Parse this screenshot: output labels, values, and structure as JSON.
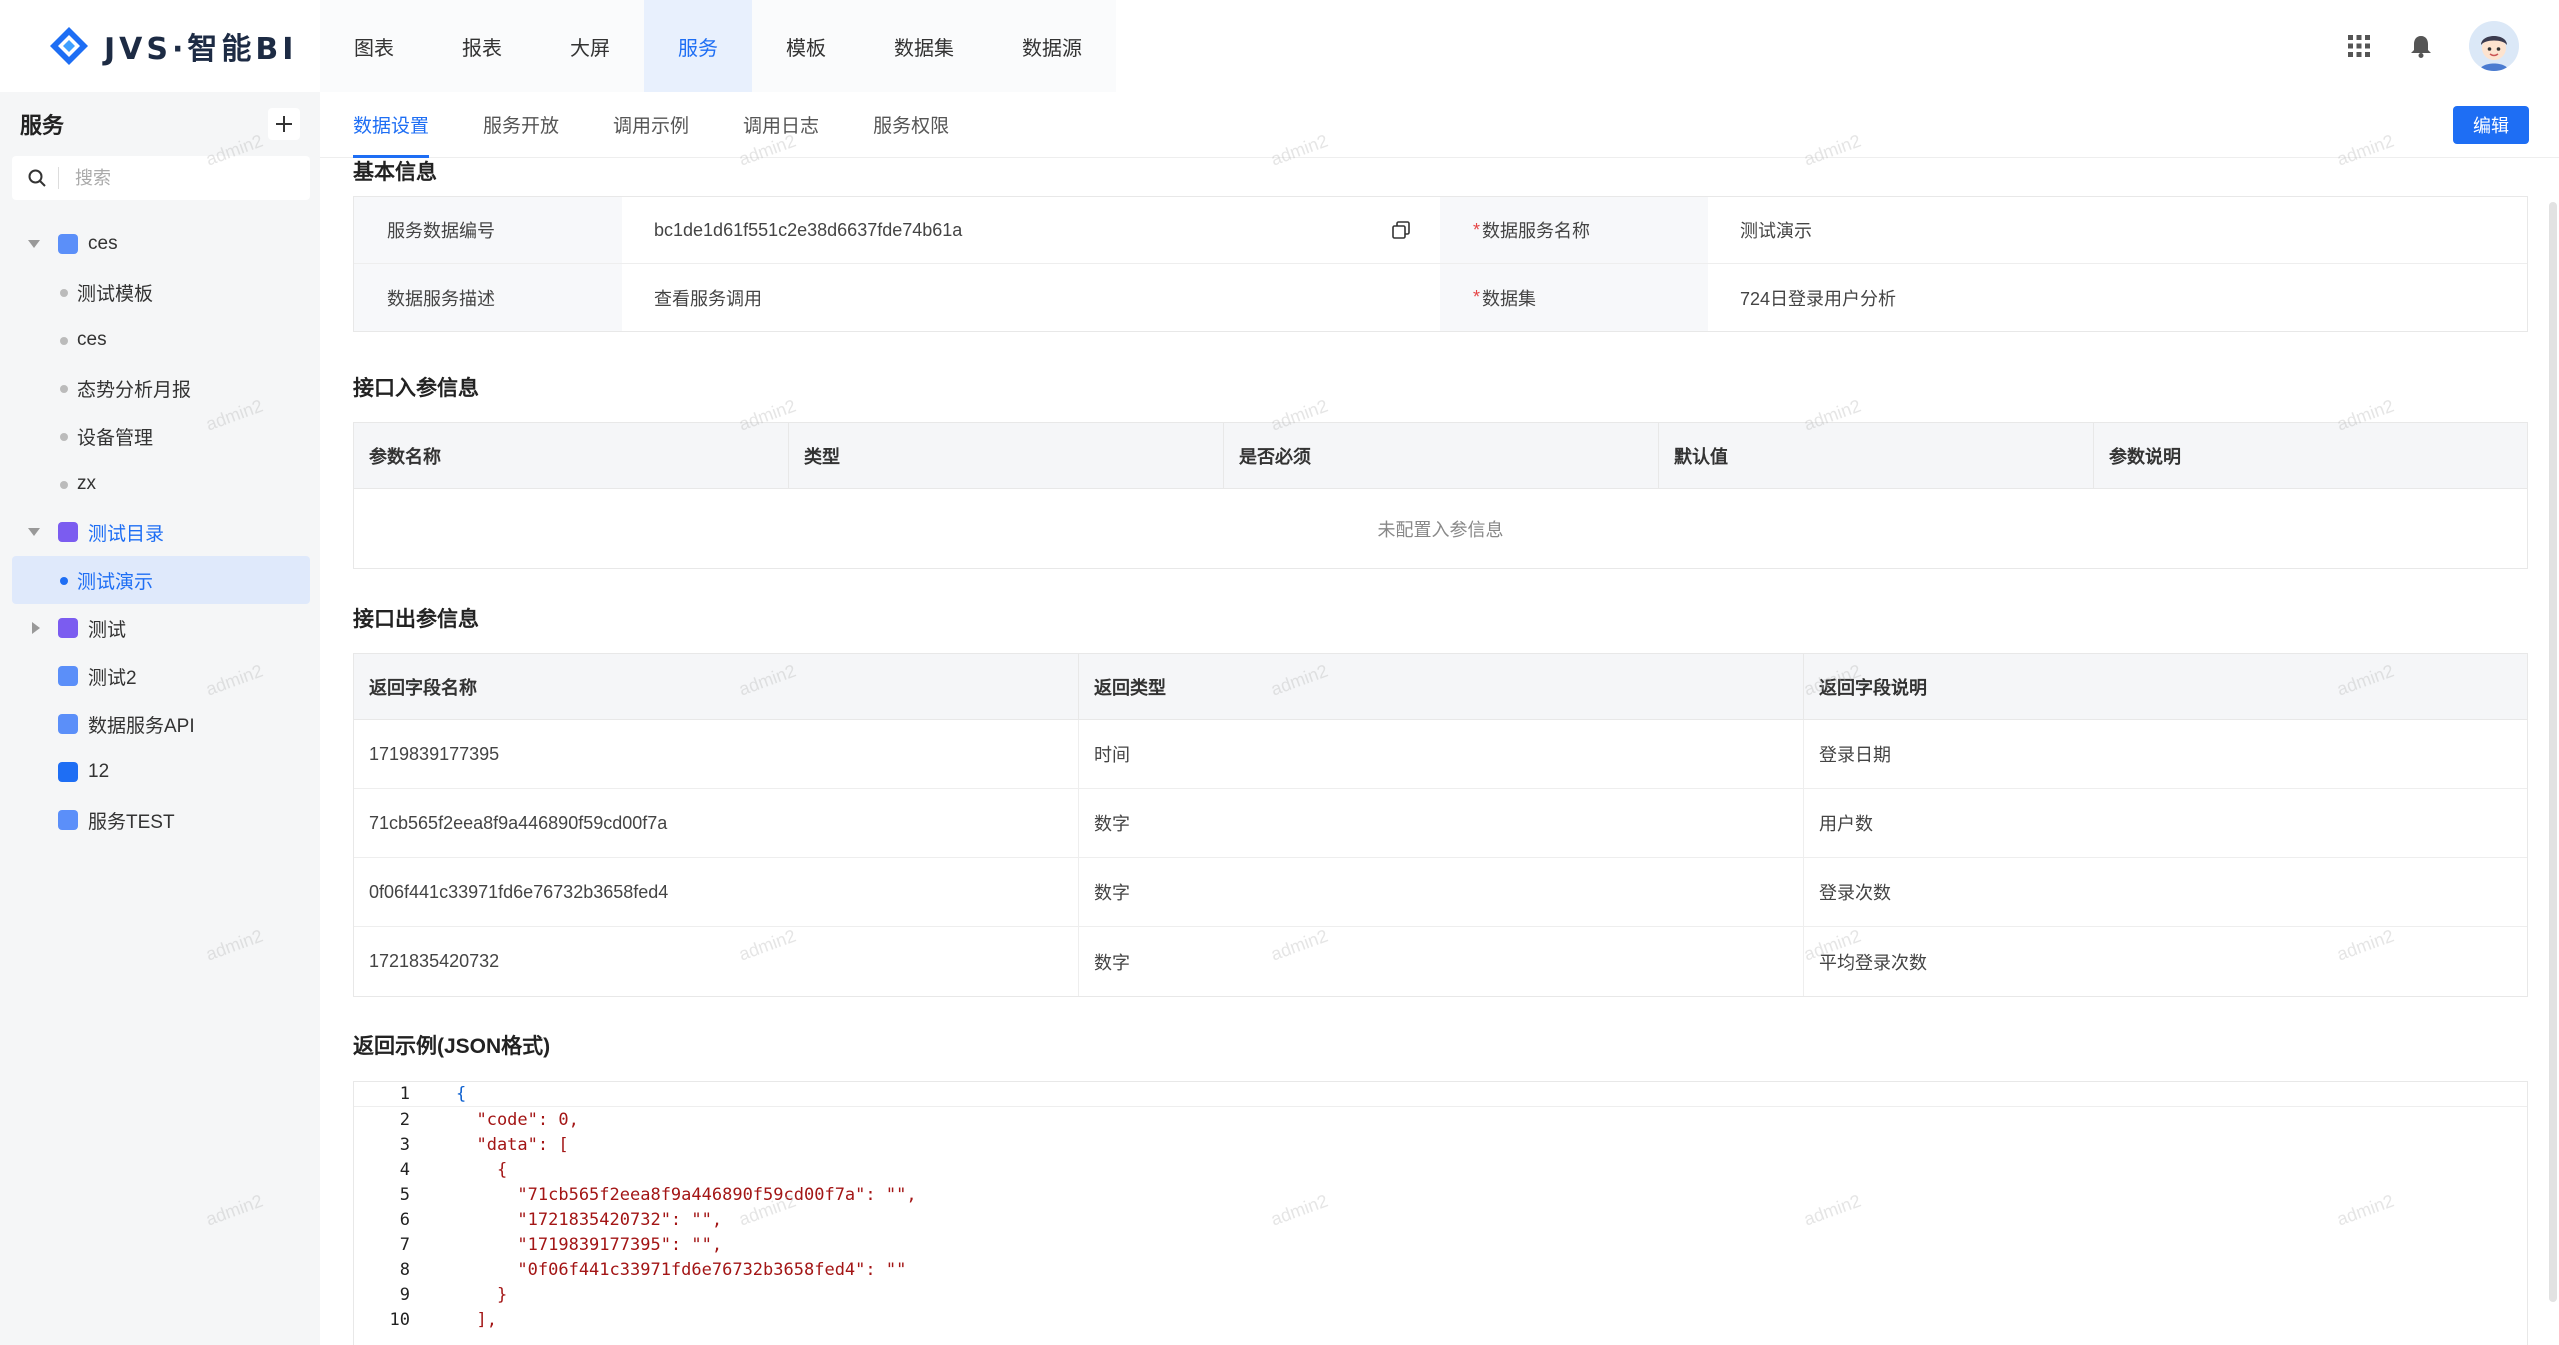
{
  "app": {
    "logo_text": "JVS·智能BI",
    "brand_color": "#1e6ef4"
  },
  "nav": {
    "items": [
      {
        "label": "图表"
      },
      {
        "label": "报表"
      },
      {
        "label": "大屏"
      },
      {
        "label": "服务",
        "active": true
      },
      {
        "label": "模板"
      },
      {
        "label": "数据集"
      },
      {
        "label": "数据源"
      }
    ]
  },
  "topright": {
    "apps_icon": "grid-apps-icon",
    "bell_icon": "bell-icon",
    "avatar_icon": "user-avatar"
  },
  "sidebar": {
    "title": "服务",
    "add_icon": "plus-icon",
    "search_placeholder": "搜索",
    "items": [
      {
        "label": "ces",
        "type": "folder",
        "expanded": true,
        "icon_color": "#5b8ff9"
      },
      {
        "label": "测试模板",
        "type": "leaf"
      },
      {
        "label": "ces",
        "type": "leaf"
      },
      {
        "label": "态势分析月报",
        "type": "leaf"
      },
      {
        "label": "设备管理",
        "type": "leaf"
      },
      {
        "label": "zx",
        "type": "leaf"
      },
      {
        "label": "测试目录",
        "type": "folder",
        "expanded": true,
        "icon_color": "#7b5cf0"
      },
      {
        "label": "测试演示",
        "type": "leaf",
        "active": true
      },
      {
        "label": "测试",
        "type": "folder",
        "expanded": false,
        "icon_color": "#7b5cf0"
      },
      {
        "label": "测试2",
        "type": "folder",
        "icon_color": "#5b8ff9"
      },
      {
        "label": "数据服务API",
        "type": "folder",
        "icon_color": "#5b8ff9"
      },
      {
        "label": "12",
        "type": "folder",
        "icon_color": "#1e6ef4"
      },
      {
        "label": "服务TEST",
        "type": "folder",
        "icon_color": "#5b8ff9"
      }
    ]
  },
  "tabs": {
    "items": [
      {
        "label": "数据设置",
        "active": true
      },
      {
        "label": "服务开放"
      },
      {
        "label": "调用示例"
      },
      {
        "label": "调用日志"
      },
      {
        "label": "服务权限"
      }
    ],
    "edit_label": "编辑"
  },
  "basic_info": {
    "title": "基本信息",
    "id_label": "服务数据编号",
    "id_value": "bc1de1d61f551c2e38d6637fde74b61a",
    "name_label": "数据服务名称",
    "name_value": "测试演示",
    "desc_label": "数据服务描述",
    "desc_value": "查看服务调用",
    "dataset_label": "数据集",
    "dataset_value": "724日登录用户分析",
    "required_mark": "*"
  },
  "input_params": {
    "title": "接口入参信息",
    "columns": [
      "参数名称",
      "类型",
      "是否必须",
      "默认值",
      "参数说明"
    ],
    "empty_text": "未配置入参信息"
  },
  "output_params": {
    "title": "接口出参信息",
    "columns": [
      "返回字段名称",
      "返回类型",
      "返回字段说明"
    ],
    "rows": [
      [
        "1719839177395",
        "时间",
        "登录日期"
      ],
      [
        "71cb565f2eea8f9a446890f59cd00f7a",
        "数字",
        "用户数"
      ],
      [
        "0f06f441c33971fd6e76732b3658fed4",
        "数字",
        "登录次数"
      ],
      [
        "1721835420732",
        "数字",
        "平均登录次数"
      ]
    ]
  },
  "example": {
    "title": "返回示例(JSON格式)",
    "lines": [
      {
        "n": "1",
        "t": "{"
      },
      {
        "n": "2",
        "t": "  \"code\": 0,"
      },
      {
        "n": "3",
        "t": "  \"data\": ["
      },
      {
        "n": "4",
        "t": "    {"
      },
      {
        "n": "5",
        "t": "      \"71cb565f2eea8f9a446890f59cd00f7a\": \"\","
      },
      {
        "n": "6",
        "t": "      \"1721835420732\": \"\","
      },
      {
        "n": "7",
        "t": "      \"1719839177395\": \"\","
      },
      {
        "n": "8",
        "t": "      \"0f06f441c33971fd6e76732b3658fed4\": \"\""
      },
      {
        "n": "9",
        "t": "    }"
      },
      {
        "n": "10",
        "t": "  ],"
      }
    ]
  },
  "watermark_text": "admin2"
}
